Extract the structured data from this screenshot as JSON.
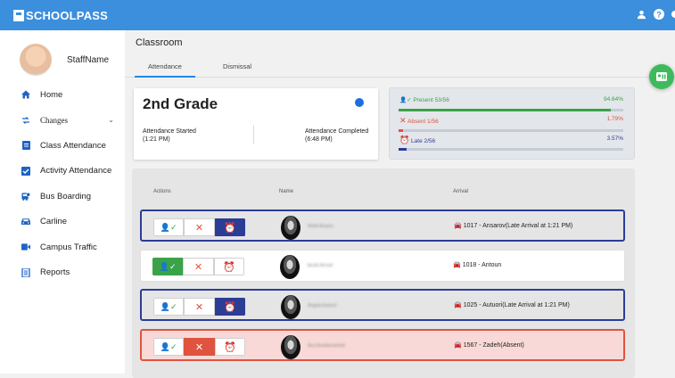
{
  "app": {
    "brand": "SCHOOLPASS"
  },
  "profile": {
    "name": "StaffName"
  },
  "sidebar": {
    "items": [
      {
        "label": "Home",
        "icon": "home-icon"
      },
      {
        "label": "Changes",
        "icon": "swap-icon"
      },
      {
        "label": "Class Attendance",
        "icon": "class-attendance-icon"
      },
      {
        "label": "Activity Attendance",
        "icon": "checkbox-icon"
      },
      {
        "label": "Bus Boarding",
        "icon": "bus-icon"
      },
      {
        "label": "Carline",
        "icon": "car-icon"
      },
      {
        "label": "Campus Traffic",
        "icon": "video-icon"
      },
      {
        "label": "Reports",
        "icon": "reports-icon"
      }
    ]
  },
  "main": {
    "breadcrumb": "Classroom",
    "tabs": [
      {
        "label": "Attendance"
      },
      {
        "label": "Dismissal"
      }
    ],
    "grade": {
      "title": "2nd Grade",
      "started_label": "Attendance Started",
      "started_time": "(1:21 PM)",
      "completed_label": "Attendance Completed",
      "completed_time": "(6:48 PM)"
    },
    "stats": {
      "present": {
        "label": "Present 53/56",
        "pct": "94.64%",
        "fraction": 0.9464,
        "color": "#3aa348"
      },
      "absent": {
        "label": "Absent 1/56",
        "pct": "1.79%",
        "fraction": 0.0179,
        "color": "#e0533e"
      },
      "late": {
        "label": "Late 2/56",
        "pct": "3.57%",
        "fraction": 0.0357,
        "color": "#2c3d96"
      }
    },
    "table": {
      "headers": {
        "actions": "Actions",
        "name": "Name",
        "arrival": "Arrival"
      },
      "rows": [
        {
          "status": "late",
          "name": "Heidi Alvarez",
          "arrival": "1017 - Ansarov(Late Arrival at 1:21 PM)"
        },
        {
          "status": "present",
          "name": "Jacob Arnout",
          "arrival": "1018 - Antoun"
        },
        {
          "status": "late",
          "name": "Angela Autuori",
          "arrival": "1025 - Autuori(Late Arrival at 1:21 PM)"
        },
        {
          "status": "absent",
          "name": "Ava Avanbenarhah",
          "arrival": "1567 - Zadeh(Absent)"
        }
      ]
    }
  },
  "colors": {
    "topbar": "#3b8fdc",
    "present": "#3aa348",
    "absent": "#e0533e",
    "late": "#2c3d96",
    "fab": "#3dbb5c"
  }
}
